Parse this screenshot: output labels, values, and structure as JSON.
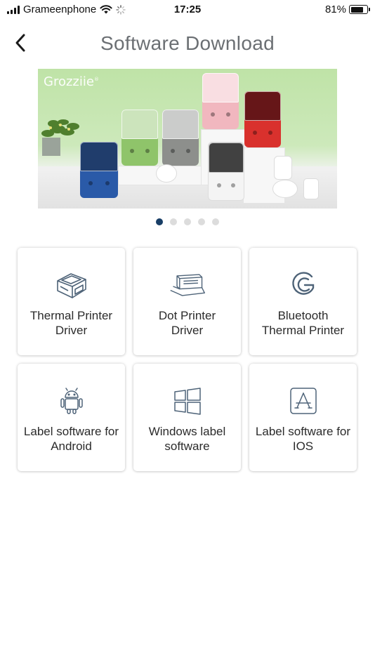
{
  "status_bar": {
    "carrier": "Grameenphone",
    "time": "17:25",
    "battery_percent": "81%",
    "battery_level": 0.81
  },
  "header": {
    "title": "Software Download",
    "back_icon": "chevron-left-icon"
  },
  "banner": {
    "brand": "Grozziie",
    "brand_mark": "®",
    "printer_colors": [
      "#2a5aa8",
      "#8fc46a",
      "#8d8f8c",
      "#f1b7bf",
      "#d9312d",
      "#f4f4f4"
    ],
    "background_color": "#c9e6b5"
  },
  "carousel": {
    "total": 5,
    "active_index": 0,
    "active_color": "#183e66"
  },
  "options": [
    {
      "label": "Thermal Printer\nDriver",
      "icon": "thermal-printer-icon"
    },
    {
      "label": "Dot Printer\nDriver",
      "icon": "dot-printer-icon"
    },
    {
      "label": "Bluetooth\nThermal Printer",
      "icon": "bluetooth-printer-icon"
    },
    {
      "label": "Label software for\nAndroid",
      "icon": "android-icon"
    },
    {
      "label": "Windows label\nsoftware",
      "icon": "windows-icon"
    },
    {
      "label": "Label software for\nIOS",
      "icon": "app-store-icon"
    }
  ],
  "colors": {
    "icon_stroke": "#4e6378",
    "title_text": "#6b6f73"
  }
}
